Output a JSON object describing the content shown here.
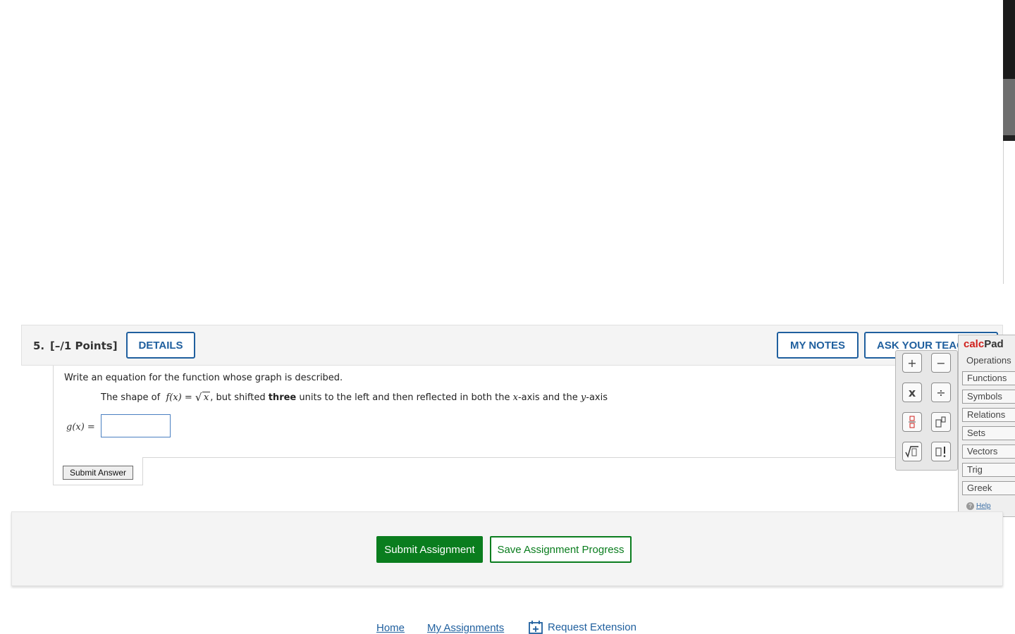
{
  "question": {
    "number": "5.",
    "points": "[–/1 Points]",
    "details_label": "DETAILS",
    "my_notes_label": "MY NOTES",
    "ask_teacher_label": "ASK YOUR TEACHER",
    "prompt": "Write an equation for the function whose graph is described.",
    "statement": {
      "prefix": "The shape of",
      "function": "f(x) =",
      "radicand": "x",
      "middle": ", but shifted",
      "emphasis": "three",
      "suffix_1": "units to the left and then reflected in both the",
      "axis_x": "x",
      "suffix_2": "-axis and the",
      "axis_y": "y",
      "suffix_3": "-axis"
    },
    "answer_label": "g(x) =",
    "answer_value": "",
    "submit_answer_label": "Submit Answer"
  },
  "calcpad": {
    "title_calc": "calc",
    "title_pad": "Pad",
    "section": "Operations",
    "tabs": [
      "Functions",
      "Symbols",
      "Relations",
      "Sets",
      "Vectors",
      "Trig",
      "Greek"
    ],
    "help_label": "Help",
    "buttons": [
      "+",
      "−",
      "x",
      "÷",
      "fraction",
      "superscript",
      "sqrt",
      "factorial"
    ]
  },
  "actions": {
    "submit_assignment": "Submit Assignment",
    "save_progress": "Save Assignment Progress"
  },
  "footer": {
    "home": "Home",
    "my_assignments": "My Assignments",
    "request_extension": "Request Extension"
  },
  "colors": {
    "primary_blue": "#1f5f9e",
    "success_green": "#0a7d1e",
    "calc_red": "#d0201c"
  }
}
